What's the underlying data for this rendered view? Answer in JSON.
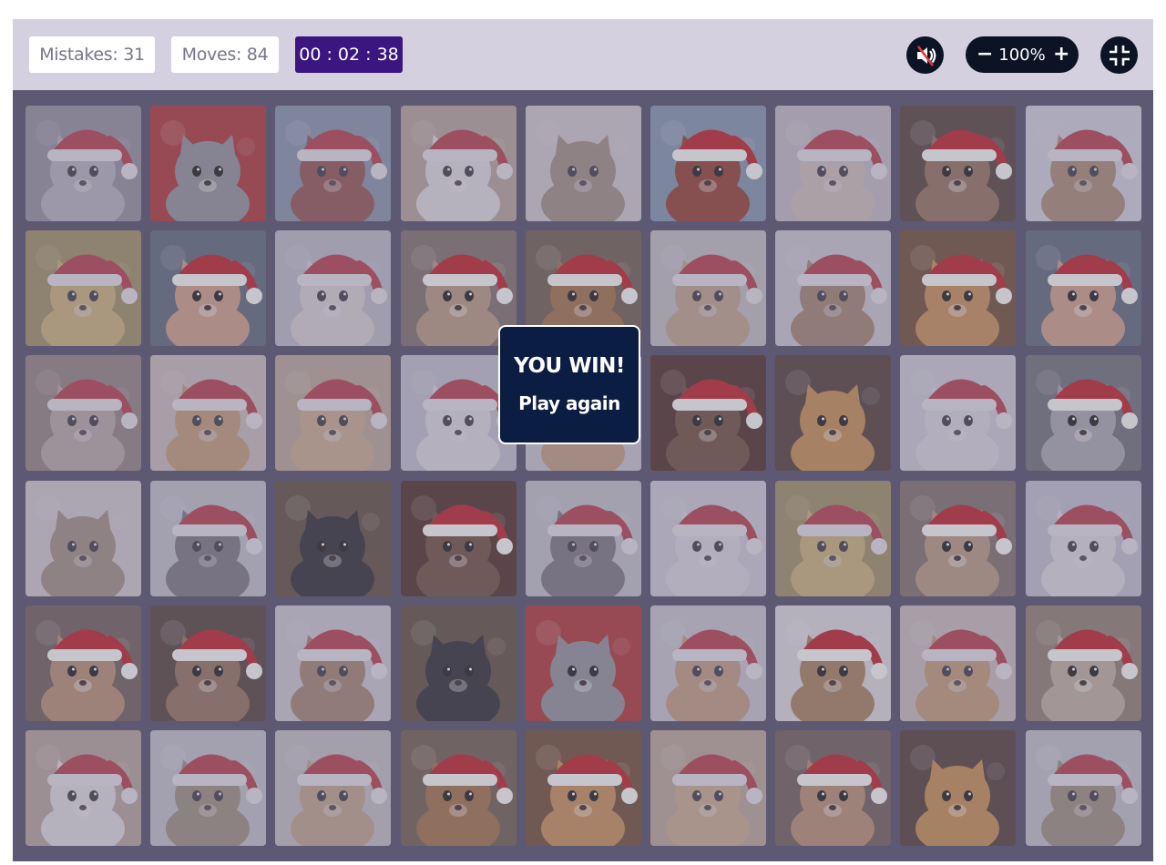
{
  "stats": {
    "mistakes": "Mistakes: 31",
    "moves": "Moves: 84",
    "timer": "00 : 02 : 38"
  },
  "controls": {
    "sound_icon": "speaker-muted-icon",
    "zoom_out_label": "−",
    "zoom_value": "100%",
    "zoom_in_label": "+",
    "fullscreen_icon": "exit-fullscreen-icon"
  },
  "dialog": {
    "title": "YOU WIN!",
    "action": "Play again"
  },
  "board": {
    "rows": 6,
    "columns": 9,
    "cards": [
      {
        "animal": "kitten",
        "bg": "#8c8a92",
        "fur": "#b9b8bf",
        "hat": true,
        "dim": true
      },
      {
        "animal": "grey cat with bow",
        "bg": "#a83232",
        "fur": "#8d8e95",
        "hat": false,
        "dim": false
      },
      {
        "animal": "chicken",
        "bg": "#7e90a8",
        "fur": "#8e3b2f",
        "hat": true,
        "dim": true
      },
      {
        "animal": "white cat in mug",
        "bg": "#b9a58f",
        "fur": "#eeeeea",
        "hat": true,
        "dim": true
      },
      {
        "animal": "kitten with gift",
        "bg": "#d8d4cf",
        "fur": "#9b8a72",
        "hat": false,
        "dim": true
      },
      {
        "animal": "chicken",
        "bg": "#7e90a8",
        "fur": "#8e3b2f",
        "hat": true,
        "dim": false
      },
      {
        "animal": "hamster",
        "bg": "#c9c3c6",
        "fur": "#d8c8b6",
        "hat": true,
        "dim": true
      },
      {
        "animal": "puppy",
        "bg": "#4f3f38",
        "fur": "#8f6d5a",
        "hat": true,
        "dim": false
      },
      {
        "animal": "puppy in snow",
        "bg": "#dcdde3",
        "fur": "#a8835c",
        "hat": true,
        "dim": true
      },
      {
        "animal": "chick",
        "bg": "#9c8a45",
        "fur": "#d5b565",
        "hat": true,
        "dim": true
      },
      {
        "animal": "pig",
        "bg": "#5a6578",
        "fur": "#c99a82",
        "hat": true,
        "dim": false
      },
      {
        "animal": "hamster",
        "bg": "#bfc1c9",
        "fur": "#e5e0da",
        "hat": true,
        "dim": true
      },
      {
        "animal": "rabbit",
        "bg": "#7b6c66",
        "fur": "#b2957b",
        "hat": true,
        "dim": false
      },
      {
        "animal": "puppy",
        "bg": "#6b5a4c",
        "fur": "#9b6c45",
        "hat": true,
        "dim": false
      },
      {
        "animal": "husky",
        "bg": "#c9c7c3",
        "fur": "#c8a47a",
        "hat": true,
        "dim": true
      },
      {
        "animal": "puppy",
        "bg": "#d5d3d6",
        "fur": "#a07b5a",
        "hat": true,
        "dim": true
      },
      {
        "animal": "tabby cat",
        "bg": "#6e4b33",
        "fur": "#c18b55",
        "hat": true,
        "dim": false
      },
      {
        "animal": "pig",
        "bg": "#5a6578",
        "fur": "#c99a82",
        "hat": true,
        "dim": false
      },
      {
        "animal": "ferret",
        "bg": "#8b7a6c",
        "fur": "#b9ab9c",
        "hat": true,
        "dim": true
      },
      {
        "animal": "golden puppy",
        "bg": "#cfc5b9",
        "fur": "#c69a61",
        "hat": true,
        "dim": true
      },
      {
        "animal": "golden puppy",
        "bg": "#bfa98c",
        "fur": "#d3b07c",
        "hat": true,
        "dim": true
      },
      {
        "animal": "white puppy",
        "bg": "#c6c9d2",
        "fur": "#ecebea",
        "hat": true,
        "dim": true
      },
      {
        "animal": "corgi",
        "bg": "#d0cfd3",
        "fur": "#c79a6d",
        "hat": true,
        "dim": true
      },
      {
        "animal": "otter by fire",
        "bg": "#4a2d24",
        "fur": "#6b4c3b",
        "hat": true,
        "dim": false
      },
      {
        "animal": "puppy in box",
        "bg": "#4d3b35",
        "fur": "#c1884d",
        "hat": false,
        "dim": false
      },
      {
        "animal": "bunny",
        "bg": "#d7d6dd",
        "fur": "#e8e6e8",
        "hat": true,
        "dim": true
      },
      {
        "animal": "grey kitten",
        "bg": "#6b6c76",
        "fur": "#a3a3ab",
        "hat": true,
        "dim": false
      },
      {
        "animal": "kitten with gift",
        "bg": "#d8d4cf",
        "fur": "#9b8a72",
        "hat": false,
        "dim": true
      },
      {
        "animal": "raccoon",
        "bg": "#c8cace",
        "fur": "#6c6a6c",
        "hat": true,
        "dim": true
      },
      {
        "animal": "black kitten",
        "bg": "#5b4a3b",
        "fur": "#2a2a2e",
        "hat": false,
        "dim": false
      },
      {
        "animal": "otter by fire",
        "bg": "#4a2d24",
        "fur": "#6b4c3b",
        "hat": true,
        "dim": false
      },
      {
        "animal": "raccoon",
        "bg": "#c8cace",
        "fur": "#6c6a6c",
        "hat": true,
        "dim": true
      },
      {
        "animal": "bunny",
        "bg": "#d7d6dd",
        "fur": "#e8e6e8",
        "hat": true,
        "dim": true
      },
      {
        "animal": "chick",
        "bg": "#9c8a45",
        "fur": "#d5b565",
        "hat": true,
        "dim": true
      },
      {
        "animal": "rabbit",
        "bg": "#7b6c66",
        "fur": "#b2957b",
        "hat": true,
        "dim": false
      },
      {
        "animal": "white puppy",
        "bg": "#c6c9d2",
        "fur": "#ecebea",
        "hat": true,
        "dim": true
      },
      {
        "animal": "hamster",
        "bg": "#6b5a55",
        "fur": "#b08b6e",
        "hat": true,
        "dim": false
      },
      {
        "animal": "puppy",
        "bg": "#4f3f38",
        "fur": "#8f6d5a",
        "hat": true,
        "dim": false
      },
      {
        "animal": "puppy",
        "bg": "#d5d3d6",
        "fur": "#a07b5a",
        "hat": true,
        "dim": true
      },
      {
        "animal": "black kitten",
        "bg": "#5b4a3b",
        "fur": "#2a2a2e",
        "hat": false,
        "dim": false
      },
      {
        "animal": "grey cat with bow",
        "bg": "#a83232",
        "fur": "#8d8e95",
        "hat": false,
        "dim": false
      },
      {
        "animal": "corgi",
        "bg": "#d0cfd3",
        "fur": "#c79a6d",
        "hat": true,
        "dim": true
      },
      {
        "animal": "puppy",
        "bg": "#d5d3d6",
        "fur": "#a07b5a",
        "hat": true,
        "dim": false
      },
      {
        "animal": "golden puppy",
        "bg": "#cfc5b9",
        "fur": "#c69a61",
        "hat": true,
        "dim": true
      },
      {
        "animal": "ferret",
        "bg": "#8b7a6c",
        "fur": "#b9ab9c",
        "hat": true,
        "dim": false
      },
      {
        "animal": "white cat in mug",
        "bg": "#b9a58f",
        "fur": "#eeeeea",
        "hat": true,
        "dim": true
      },
      {
        "animal": "duck",
        "bg": "#c9cacc",
        "fur": "#9a8a6d",
        "hat": true,
        "dim": true
      },
      {
        "animal": "husky",
        "bg": "#c9c7c3",
        "fur": "#c8a47a",
        "hat": true,
        "dim": true
      },
      {
        "animal": "puppy",
        "bg": "#6b5a4c",
        "fur": "#9b6c45",
        "hat": true,
        "dim": false
      },
      {
        "animal": "tabby cat",
        "bg": "#6e4b33",
        "fur": "#c18b55",
        "hat": true,
        "dim": false
      },
      {
        "animal": "golden puppy",
        "bg": "#bfa98c",
        "fur": "#d3b07c",
        "hat": true,
        "dim": true
      },
      {
        "animal": "hamster",
        "bg": "#6b5a55",
        "fur": "#b08b6e",
        "hat": true,
        "dim": false
      },
      {
        "animal": "puppy in box",
        "bg": "#4d3b35",
        "fur": "#c1884d",
        "hat": false,
        "dim": false
      },
      {
        "animal": "duck",
        "bg": "#c9cacc",
        "fur": "#9a8a6d",
        "hat": true,
        "dim": true
      }
    ]
  }
}
